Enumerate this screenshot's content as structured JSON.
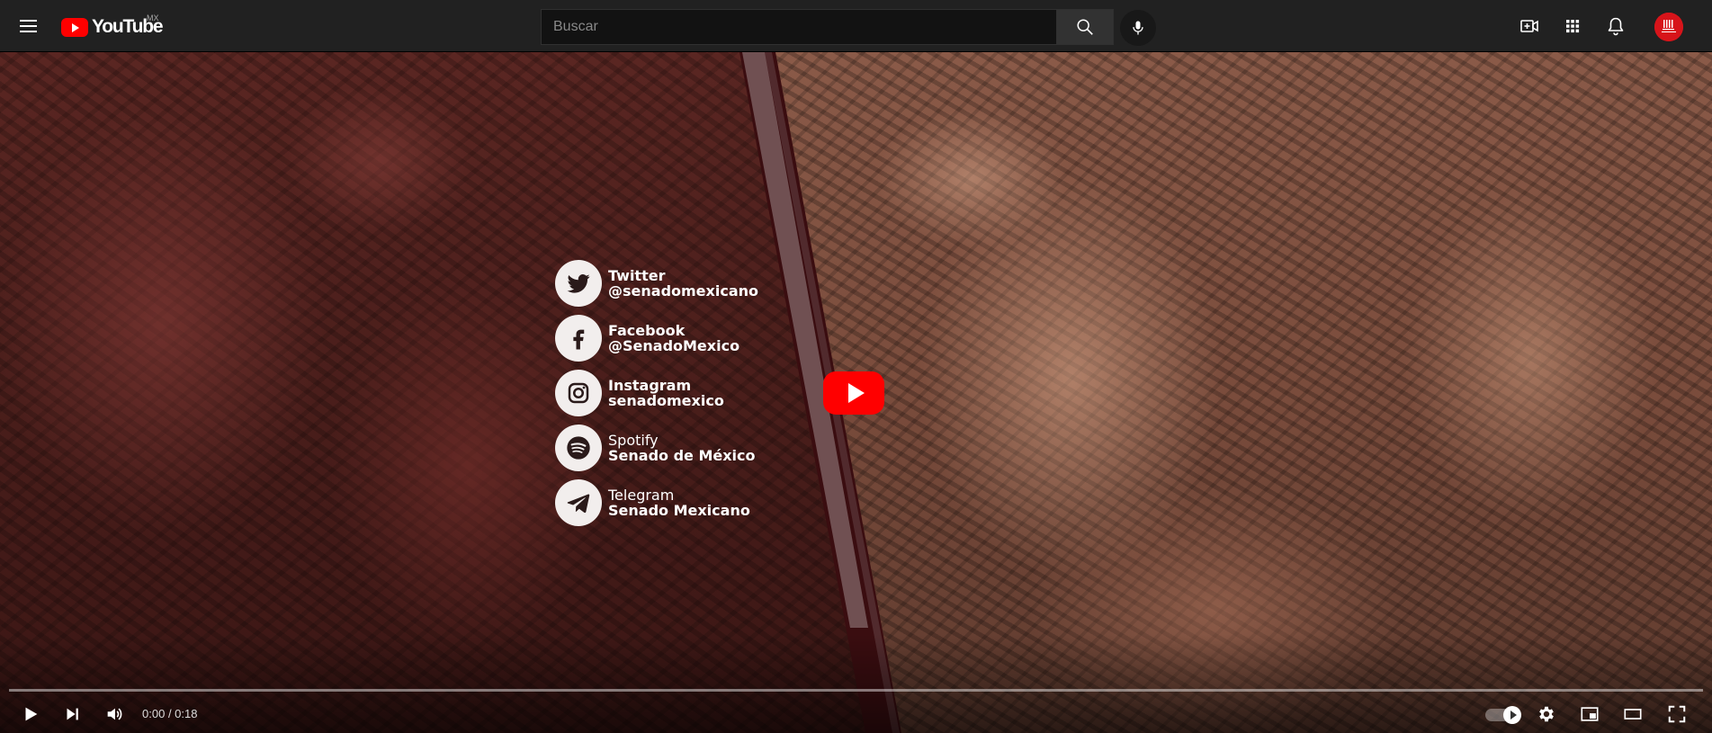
{
  "masthead": {
    "logo_text": "YouTube",
    "country_code": "MX",
    "search": {
      "placeholder": "Buscar",
      "value": ""
    },
    "icons": [
      "menu-icon",
      "search-icon",
      "microphone-icon",
      "create-video-icon",
      "apps-grid-icon",
      "notifications-bell-icon"
    ],
    "avatar_color": "#d7141a"
  },
  "player": {
    "social": [
      {
        "network": "Twitter",
        "handle": "@senadomexicano",
        "icon": "twitter-bird-icon"
      },
      {
        "network": "Facebook",
        "handle": "@SenadoMexico",
        "icon": "facebook-f-icon"
      },
      {
        "network": "Instagram",
        "handle": "senadomexico",
        "icon": "instagram-camera-icon"
      },
      {
        "network": "Spotify",
        "handle": "Senado de México",
        "icon": "spotify-icon"
      },
      {
        "network": "Telegram",
        "handle": "Senado Mexicano",
        "icon": "telegram-plane-icon"
      }
    ],
    "controls": {
      "current_time": "0:00",
      "duration": "0:18",
      "time_display": "0:00 / 0:18",
      "progress": 0.0,
      "autoplay": true
    },
    "colors": {
      "play_red": "#ff0000",
      "progress_red": "#ff0000"
    }
  }
}
